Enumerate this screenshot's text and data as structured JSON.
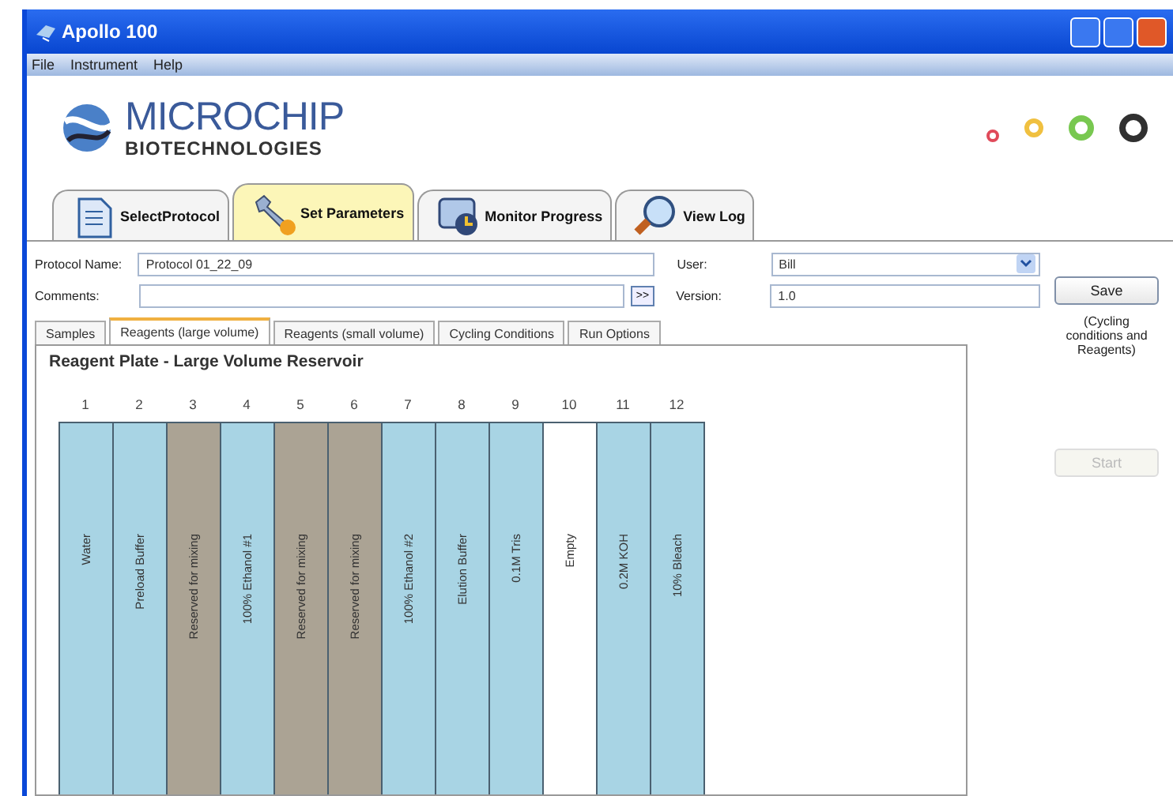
{
  "window": {
    "title": "Apollo 100"
  },
  "menu": [
    "File",
    "Instrument",
    "Help"
  ],
  "logo": {
    "name": "MICROCHIP",
    "subtitle": "BIOTECHNOLOGIES"
  },
  "indicators": [
    {
      "color": "#e04a5a"
    },
    {
      "color": "#f0c040"
    },
    {
      "color": "#78c850"
    },
    {
      "color": "#303030"
    }
  ],
  "main_tabs": [
    {
      "label": "SelectProtocol",
      "kind": "document",
      "selected": false
    },
    {
      "label": "Set Parameters",
      "kind": "wrench",
      "selected": true
    },
    {
      "label": "Monitor Progress",
      "kind": "monitor",
      "selected": false
    },
    {
      "label": "View Log",
      "kind": "magnifier",
      "selected": false
    }
  ],
  "form": {
    "protocol_name": {
      "label": "Protocol Name:",
      "value": "Protocol 01_22_09"
    },
    "comments": {
      "label": "Comments:",
      "button": ">>"
    },
    "user": {
      "label": "User:",
      "value": "Bill"
    },
    "version": {
      "label": "Version:",
      "value": "1.0"
    }
  },
  "side": {
    "save": "Save",
    "note": "(Cycling conditions and Reagents)",
    "start": {
      "label": "Start",
      "disabled": true
    }
  },
  "sub_tabs": [
    {
      "label": "Samples",
      "selected": false
    },
    {
      "label": "Reagents (large volume)",
      "selected": true
    },
    {
      "label": "Reagents (small volume)",
      "selected": false
    },
    {
      "label": "Cycling Conditions",
      "selected": false
    },
    {
      "label": "Run Options",
      "selected": false
    }
  ],
  "plate": {
    "title": "Reagent Plate - Large Volume Reservoir",
    "lanes": [
      {
        "number": "1",
        "label": "Water",
        "kind": "reagent"
      },
      {
        "number": "2",
        "label": "Preload Buffer",
        "kind": "reagent"
      },
      {
        "number": "3",
        "label": "Reserved for mixing",
        "kind": "reserved"
      },
      {
        "number": "4",
        "label": "100% Ethanol #1",
        "kind": "reagent"
      },
      {
        "number": "5",
        "label": "Reserved for mixing",
        "kind": "reserved"
      },
      {
        "number": "6",
        "label": "Reserved for mixing",
        "kind": "reserved"
      },
      {
        "number": "7",
        "label": "100% Ethanol #2",
        "kind": "reagent"
      },
      {
        "number": "8",
        "label": "Elution Buffer",
        "kind": "reagent"
      },
      {
        "number": "9",
        "label": "0.1M Tris",
        "kind": "reagent"
      },
      {
        "number": "10",
        "label": "Empty",
        "kind": "empty"
      },
      {
        "number": "11",
        "label": "0.2M KOH",
        "kind": "reagent"
      },
      {
        "number": "12",
        "label": "10% Bleach",
        "kind": "reagent"
      }
    ]
  }
}
